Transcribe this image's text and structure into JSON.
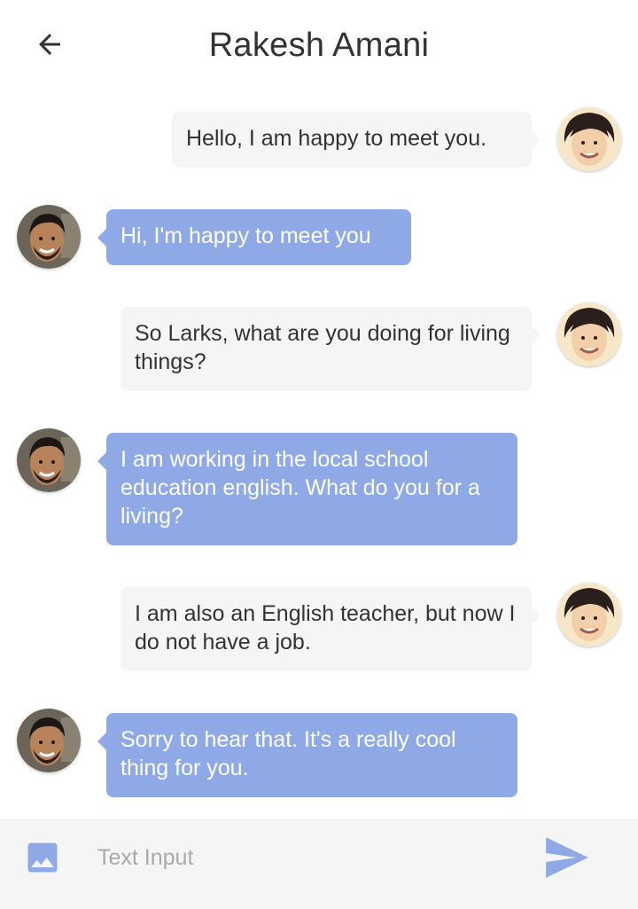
{
  "header": {
    "title": "Rakesh Amani",
    "back_icon": "arrow-left-icon"
  },
  "messages": [
    {
      "side": "right",
      "text": "Hello, I am happy to meet you.",
      "avatar": "user-avatar"
    },
    {
      "side": "left",
      "text": "Hi, I'm happy to meet you",
      "avatar": "contact-avatar"
    },
    {
      "side": "right",
      "text": "So Larks, what are you doing for living things?",
      "avatar": "user-avatar"
    },
    {
      "side": "left",
      "text": "I am working in the local school education english. What do you for a living?",
      "avatar": "contact-avatar"
    },
    {
      "side": "right",
      "text": "I am also an English teacher, but now I do not have a job.",
      "avatar": "user-avatar"
    },
    {
      "side": "left",
      "text": "Sorry to hear that. It's a really cool thing for you.",
      "avatar": "contact-avatar"
    }
  ],
  "composer": {
    "placeholder": "Text Input",
    "image_icon": "image-icon",
    "send_icon": "send-icon"
  },
  "colors": {
    "incoming_bubble": "#8fa9e6",
    "outgoing_bubble": "#f5f5f5",
    "accent": "#8fa9e6",
    "title_text": "#333333"
  }
}
